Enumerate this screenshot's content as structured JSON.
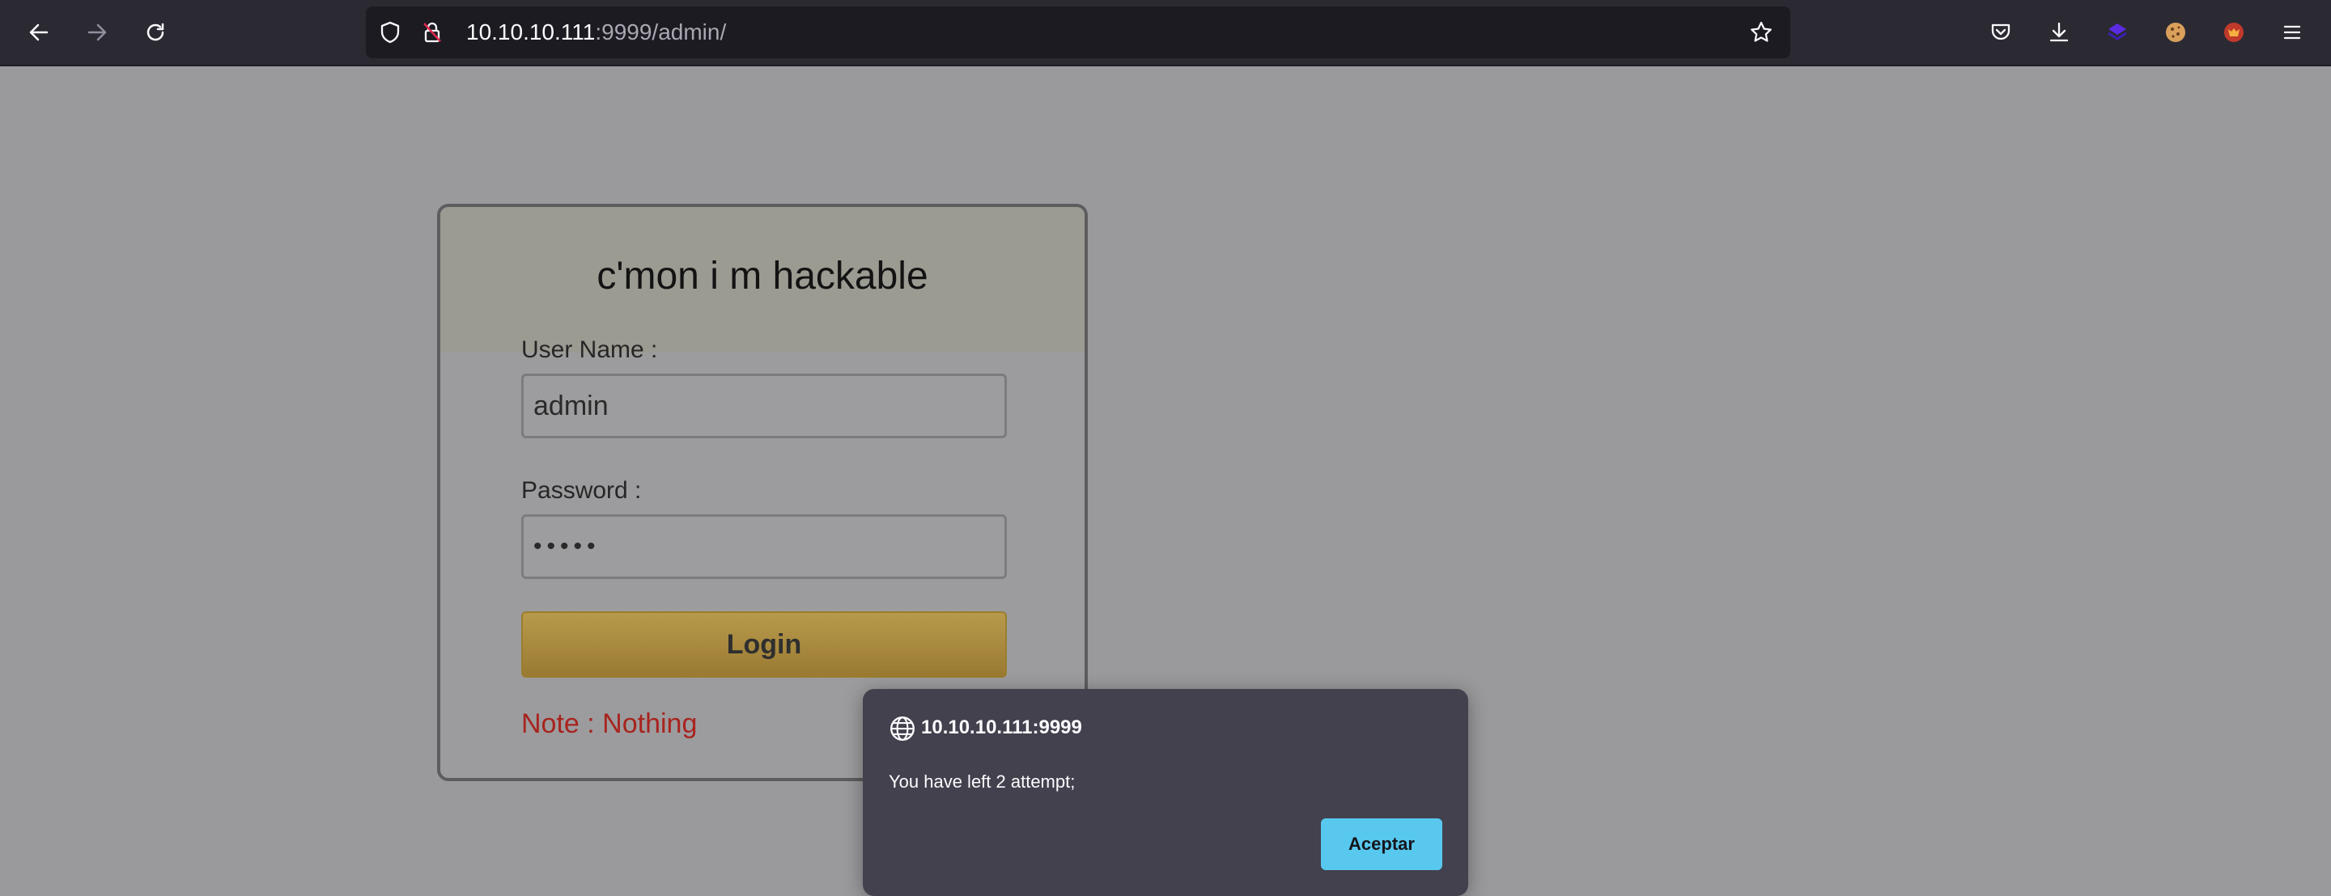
{
  "browser": {
    "url_host": "10.10.10.111",
    "url_rest": ":9999/admin/",
    "icons": [
      "back-icon",
      "forward-icon",
      "reload-icon",
      "shield-icon",
      "insecure-lock-icon",
      "bookmark-star-icon",
      "pocket-icon",
      "download-icon",
      "extension-icon",
      "cookie-icon",
      "extension-fox-icon",
      "menu-icon"
    ]
  },
  "login": {
    "title": "c'mon i m hackable",
    "username_label": "User Name :",
    "username_value": "admin",
    "password_label": "Password :",
    "password_mask": "•••••",
    "login_button": "Login",
    "note": "Note : Nothing"
  },
  "dialog": {
    "origin": "10.10.10.111:9999",
    "message": "You have left 2 attempt;",
    "accept_button": "Aceptar"
  },
  "colors": {
    "accent_button": "#58c8ef",
    "login_button": "#b89a4c",
    "note_red": "#a8241f"
  }
}
